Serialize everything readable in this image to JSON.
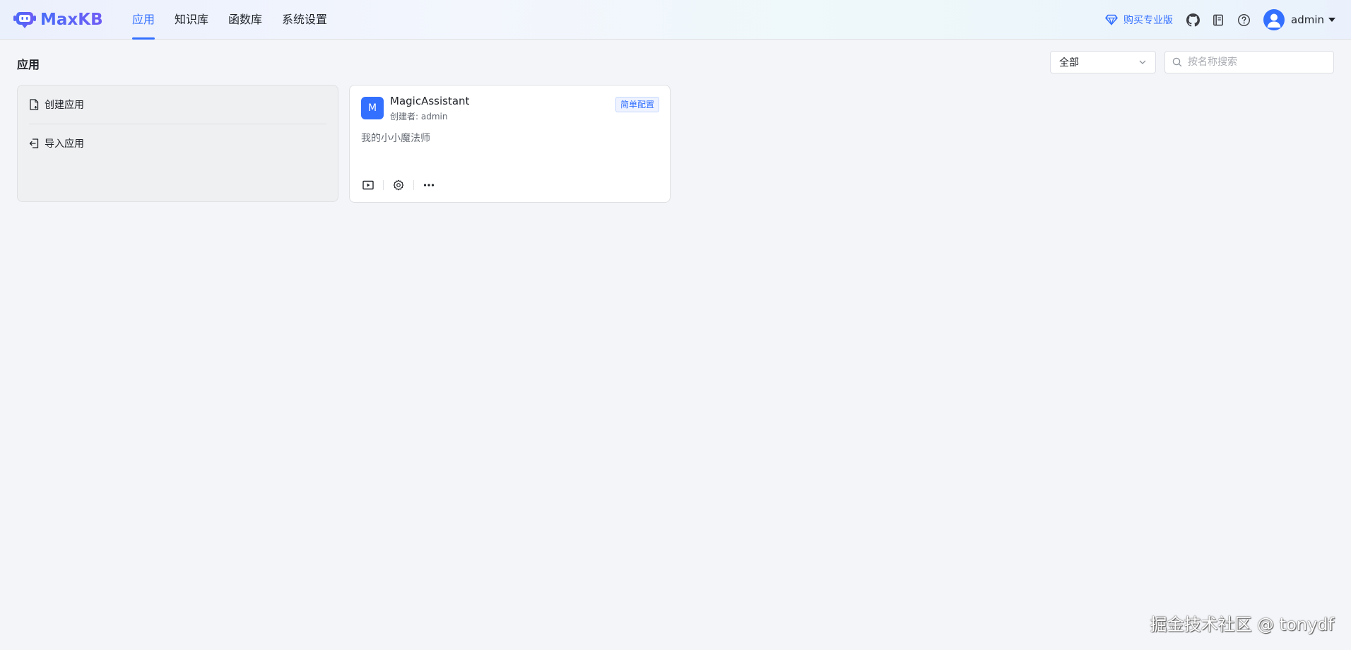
{
  "header": {
    "logo_text": "MaxKB",
    "nav": [
      {
        "label": "应用",
        "active": true
      },
      {
        "label": "知识库",
        "active": false
      },
      {
        "label": "函数库",
        "active": false
      },
      {
        "label": "系统设置",
        "active": false
      }
    ],
    "buy_pro_label": "购买专业版",
    "icons": [
      "github-icon",
      "book-icon",
      "help-icon"
    ],
    "user": {
      "name": "admin"
    }
  },
  "page": {
    "title": "应用",
    "filter": {
      "selected": "全部"
    },
    "search": {
      "placeholder": "按名称搜索",
      "value": ""
    }
  },
  "create_card": {
    "create_label": "创建应用",
    "import_label": "导入应用"
  },
  "apps": [
    {
      "avatar_letter": "M",
      "name": "MagicAssistant",
      "creator": "创建者: admin",
      "tag": "简单配置",
      "description": "我的小小魔法师"
    }
  ],
  "colors": {
    "accent": "#3370ff",
    "background": "#f4f5f8",
    "text": "#1f2329",
    "muted": "#646a73"
  },
  "watermark": "掘金技术社区 @ tonydf"
}
